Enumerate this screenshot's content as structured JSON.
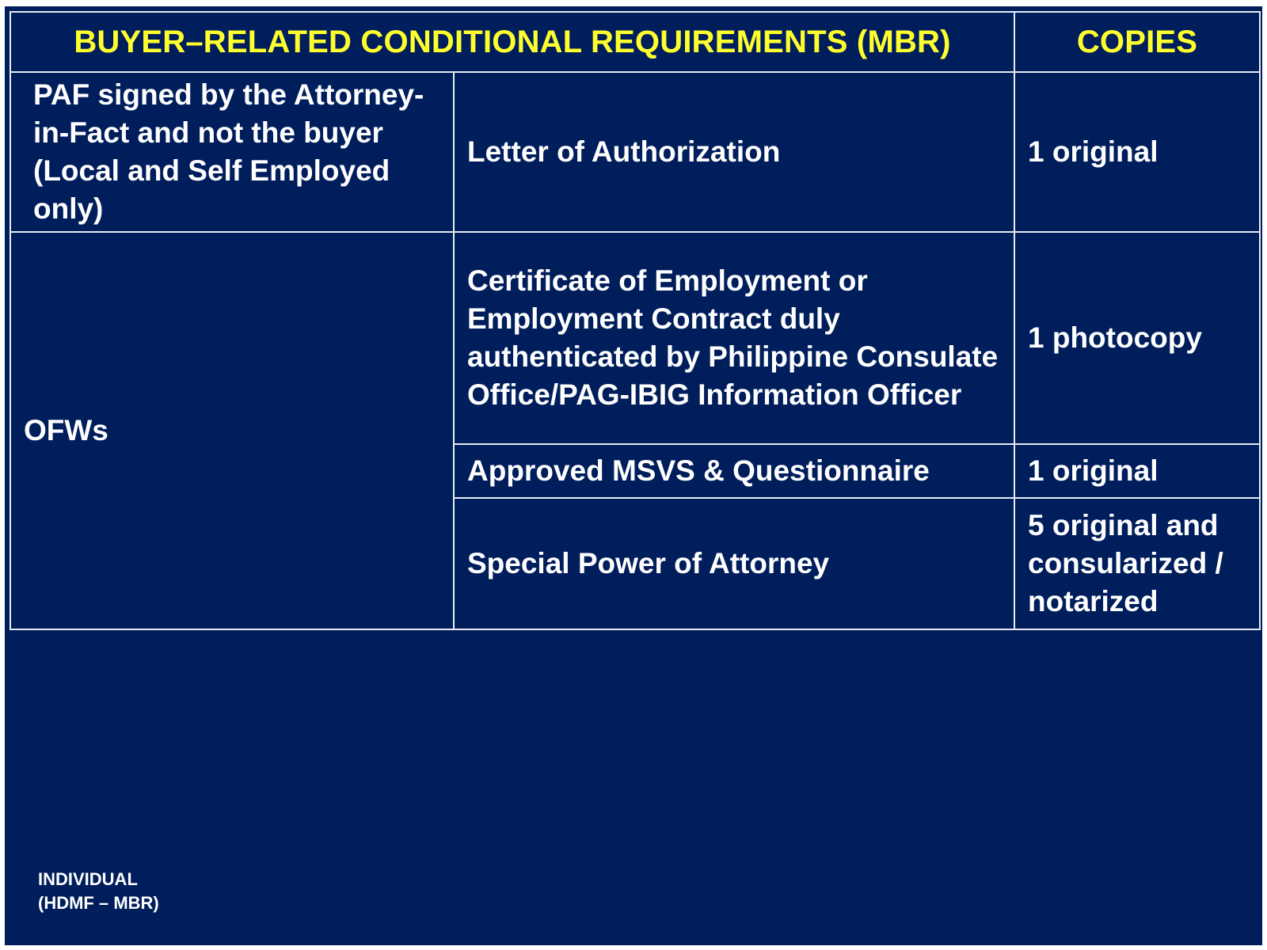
{
  "table": {
    "header": {
      "requirements": "BUYER–RELATED CONDITIONAL REQUIREMENTS (MBR)",
      "copies": "COPIES"
    },
    "rows": [
      {
        "condition": "PAF signed by the Attorney-in-Fact and not the buyer (Local and Self Employed only)",
        "document": "Letter of Authorization",
        "copies": "1 original"
      },
      {
        "condition": "OFWs",
        "document": "Certificate of Employment or Employment Contract duly authenticated by Philippine Consulate Office/PAG-IBIG Information Officer",
        "copies": "1 photocopy"
      },
      {
        "document": "Approved MSVS & Questionnaire",
        "copies": "1 original"
      },
      {
        "document": "Special Power of Attorney",
        "copies": "5 original and consularized / notarized"
      }
    ]
  },
  "footer": {
    "line1": "INDIVIDUAL",
    "line2": "(HDMF – MBR)"
  },
  "colors": {
    "background": "#001e5c",
    "header_text": "#ffff2e",
    "body_text": "#ffffff",
    "grid": "#e8ecf4"
  }
}
